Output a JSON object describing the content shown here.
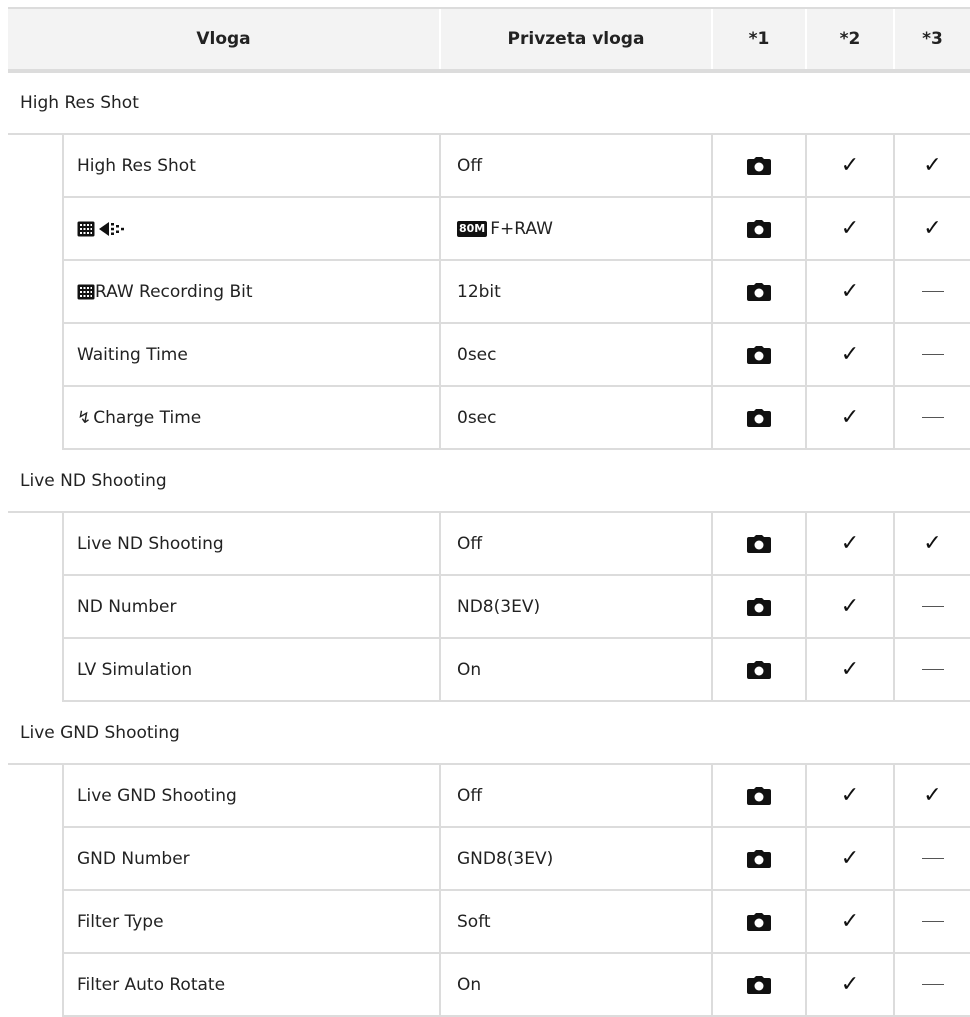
{
  "header": {
    "function": "Vloga",
    "default": "Privzeta vloga",
    "col1": "*1",
    "col2": "*2",
    "col3": "*3"
  },
  "sections": [
    {
      "title": "High Res Shot",
      "rows": [
        {
          "function": "High Res Shot",
          "default": "Off",
          "c1": "camera-icon",
          "c2": "✓",
          "c3": "✓"
        },
        {
          "function": "",
          "function_icons": [
            "high-res-grid-icon",
            "image-quality-arrow-icon"
          ],
          "default": "F+RAW",
          "default_badge": "80M",
          "c1": "camera-icon",
          "c2": "✓",
          "c3": "✓"
        },
        {
          "function": "RAW Recording Bit",
          "function_icons": [
            "high-res-grid-icon"
          ],
          "default": "12bit",
          "c1": "camera-icon",
          "c2": "✓",
          "c3": "—"
        },
        {
          "function": "Waiting Time",
          "default": "0sec",
          "c1": "camera-icon",
          "c2": "✓",
          "c3": "—"
        },
        {
          "function": "Charge Time",
          "function_icons": [
            "flash-bolt-icon"
          ],
          "default": "0sec",
          "c1": "camera-icon",
          "c2": "✓",
          "c3": "—"
        }
      ]
    },
    {
      "title": "Live ND Shooting",
      "rows": [
        {
          "function": "Live ND Shooting",
          "default": "Off",
          "c1": "camera-icon",
          "c2": "✓",
          "c3": "✓"
        },
        {
          "function": "ND Number",
          "default": "ND8(3EV)",
          "c1": "camera-icon",
          "c2": "✓",
          "c3": "—"
        },
        {
          "function": "LV Simulation",
          "default": "On",
          "c1": "camera-icon",
          "c2": "✓",
          "c3": "—"
        }
      ]
    },
    {
      "title": "Live GND Shooting",
      "rows": [
        {
          "function": "Live GND Shooting",
          "default": "Off",
          "c1": "camera-icon",
          "c2": "✓",
          "c3": "✓"
        },
        {
          "function": "GND Number",
          "default": "GND8(3EV)",
          "c1": "camera-icon",
          "c2": "✓",
          "c3": "—"
        },
        {
          "function": "Filter Type",
          "default": "Soft",
          "c1": "camera-icon",
          "c2": "✓",
          "c3": "—"
        },
        {
          "function": "Filter Auto Rotate",
          "default": "On",
          "c1": "camera-icon",
          "c2": "✓",
          "c3": "—"
        }
      ]
    }
  ]
}
